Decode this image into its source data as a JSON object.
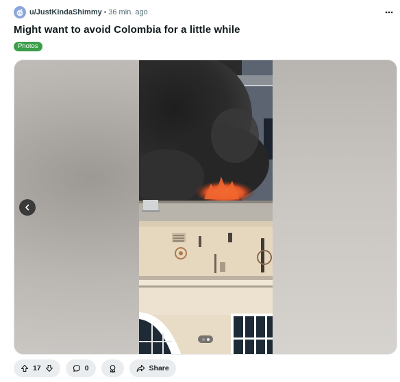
{
  "post": {
    "author": "u/JustKindaShimmy",
    "separator": "•",
    "time": "36 min. ago",
    "title": "Might want to avoid Colombia for a little while",
    "flair": "Photos"
  },
  "actions": {
    "score": "17",
    "comments": "0",
    "share_label": "Share"
  },
  "icons": {
    "avatar": "snoo-avatar-icon",
    "more": "more-options-icon",
    "prev": "chevron-left-icon",
    "upvote": "upvote-arrow-icon",
    "downvote": "downvote-arrow-icon",
    "comment": "comment-bubble-icon",
    "award": "award-icon",
    "share": "share-arrow-icon"
  },
  "colors": {
    "flair_bg": "#3a9e4a",
    "pill_bg": "#eaedef"
  }
}
